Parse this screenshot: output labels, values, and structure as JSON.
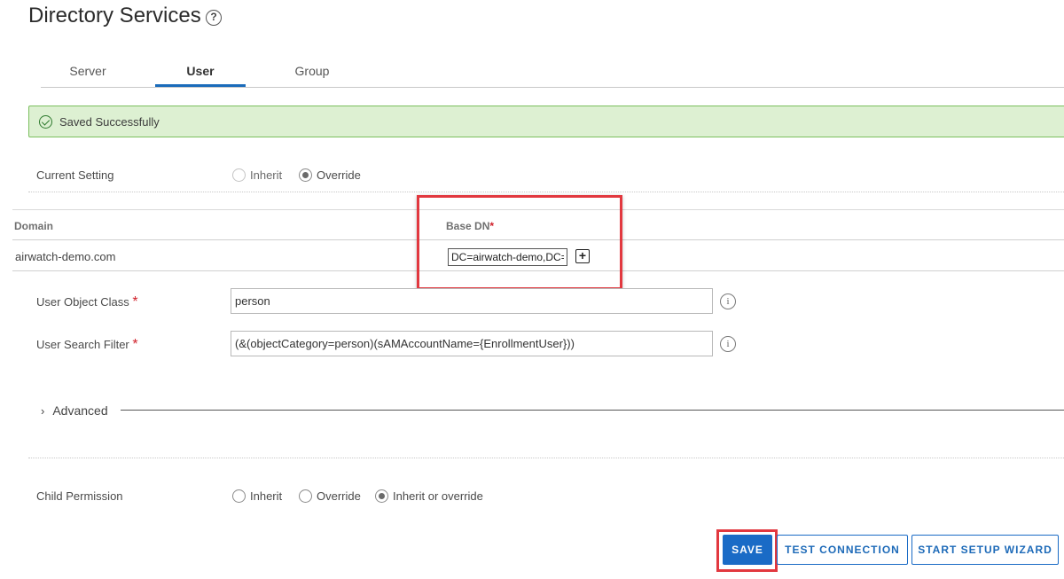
{
  "page": {
    "title": "Directory Services",
    "help_icon": "?"
  },
  "tabs": [
    {
      "label": "Server",
      "active": false
    },
    {
      "label": "User",
      "active": true
    },
    {
      "label": "Group",
      "active": false
    }
  ],
  "alert": {
    "message": "Saved Successfully",
    "icon": "check-circle-icon",
    "color": "#ddf0d2"
  },
  "current_setting": {
    "label": "Current Setting",
    "options": [
      {
        "label": "Inherit",
        "checked": false,
        "disabled": true
      },
      {
        "label": "Override",
        "checked": true,
        "disabled": false
      }
    ]
  },
  "domain_table": {
    "headers": {
      "domain": "Domain",
      "base_dn": "Base DN",
      "required_mark": "*"
    },
    "rows": [
      {
        "domain": "airwatch-demo.com",
        "base_dn": "DC=airwatch-demo,DC=",
        "add_icon": "+"
      }
    ]
  },
  "fields": {
    "user_object_class": {
      "label": "User Object Class",
      "required_mark": "*",
      "value": "person",
      "info_icon": "i"
    },
    "user_search_filter": {
      "label": "User Search Filter",
      "required_mark": "*",
      "value": "(&(objectCategory=person)(sAMAccountName={EnrollmentUser}))",
      "info_icon": "i"
    }
  },
  "advanced": {
    "label": "Advanced",
    "chevron": "›"
  },
  "child_permission": {
    "label": "Child Permission",
    "options": [
      {
        "label": "Inherit",
        "checked": false
      },
      {
        "label": "Override",
        "checked": false
      },
      {
        "label": "Inherit or override",
        "checked": true
      }
    ]
  },
  "buttons": {
    "save": "SAVE",
    "test_connection": "TEST CONNECTION",
    "start_setup_wizard": "START SETUP WIZARD"
  },
  "colors": {
    "accent": "#1a6bc6",
    "highlight": "#e2383f",
    "required": "#d0202a"
  }
}
